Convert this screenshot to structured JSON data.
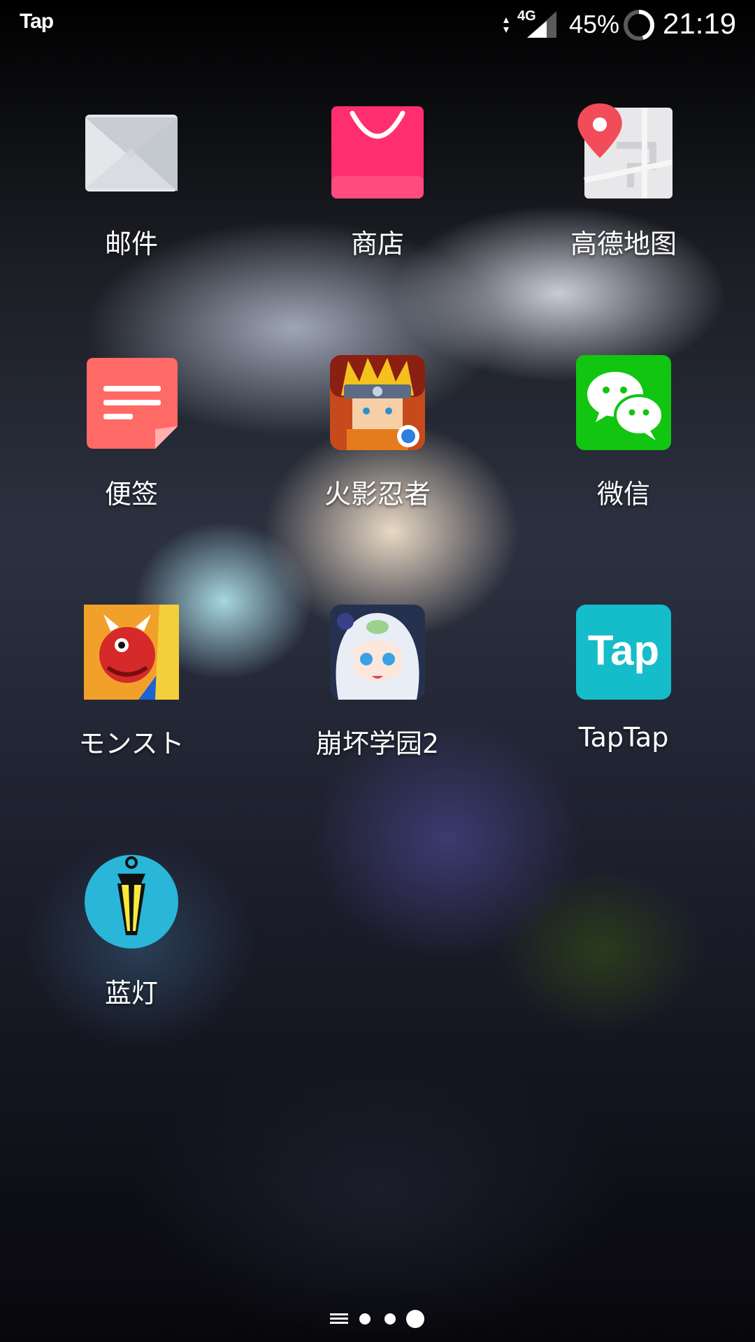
{
  "status_bar": {
    "notification_text": "Tap",
    "network": "4G",
    "battery_percent": "45%",
    "battery_level": 0.45,
    "time": "21:19"
  },
  "apps": [
    {
      "label": "邮件",
      "icon": "mail-icon",
      "color": "#e4e6ea"
    },
    {
      "label": "商店",
      "icon": "store-bag-icon",
      "color": "#ff2f6f"
    },
    {
      "label": "高德地图",
      "icon": "map-pin-icon",
      "color": "#f24c5a"
    },
    {
      "label": "便签",
      "icon": "note-icon",
      "color": "#ff6a66"
    },
    {
      "label": "火影忍者",
      "icon": "naruto-game-icon",
      "color": "#f4c21e"
    },
    {
      "label": "微信",
      "icon": "wechat-icon",
      "color": "#11c511"
    },
    {
      "label": "モンスト",
      "icon": "monst-game-icon",
      "color": "#d62929"
    },
    {
      "label": "崩坏学园2",
      "icon": "houkai-game-icon",
      "color": "#9fbad6"
    },
    {
      "label": "TapTap",
      "icon": "taptap-icon",
      "color": "#15bcc9",
      "icon_text": "Tap"
    },
    {
      "label": "蓝灯",
      "icon": "lantern-icon",
      "color": "#29b6d8"
    }
  ],
  "pager": {
    "page_count": 3,
    "current_page": 3
  }
}
